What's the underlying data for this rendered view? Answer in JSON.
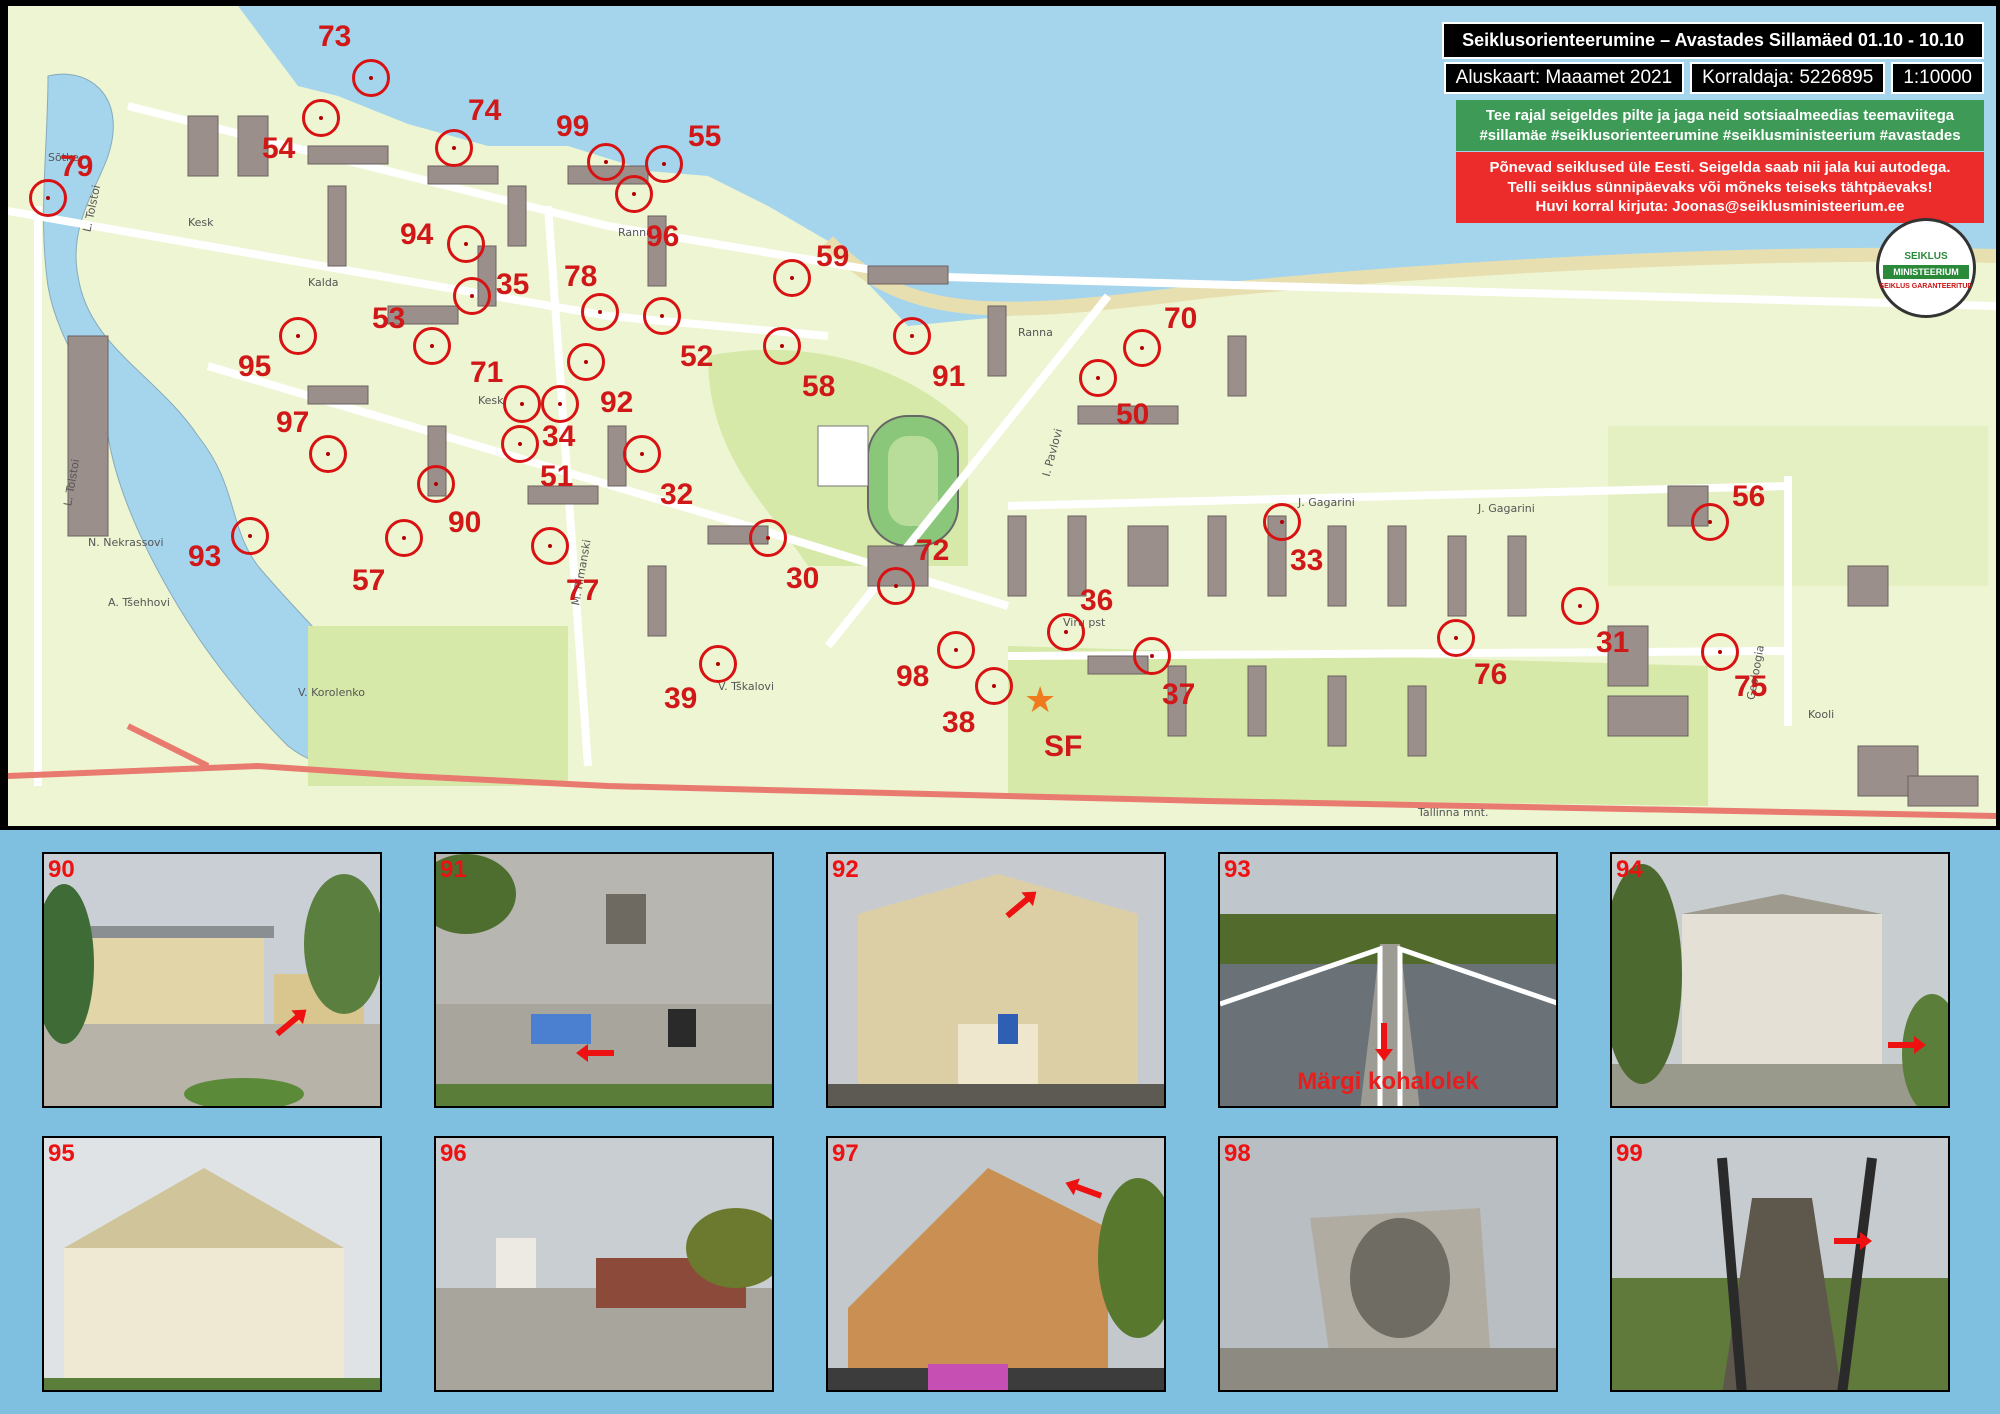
{
  "header": {
    "title": "Seiklusorienteerumine – Avastades Sillamäed 01.10 - 10.10",
    "base_map": "Aluskaart: Maaamet 2021",
    "organizer": "Korraldaja: 5226895",
    "scale": "1:10000",
    "share_note": "Tee rajal seigeldes pilte ja jaga neid sotsiaalmeedias teemaviitega",
    "hashtags": "#sillamäe #seiklusorienteerumine #seiklusministeerium #avastades",
    "promo_1": "Põnevad seiklused üle Eesti. Seigelda saab nii jala kui autodega.",
    "promo_2": "Telli seiklus sünnipäevaks või mõneks teiseks tähtpäevaks!",
    "promo_3": "Huvi korral kirjuta: Joonas@seiklusministeerium.ee"
  },
  "logo": {
    "line1": "SEIKLUS",
    "line2": "MINISTEERIUM",
    "line3": "SEIKLUS GARANTEERITUD"
  },
  "start": {
    "label": "SF"
  },
  "controls": [
    {
      "id": "73"
    },
    {
      "id": "54"
    },
    {
      "id": "74"
    },
    {
      "id": "99"
    },
    {
      "id": "55"
    },
    {
      "id": "79"
    },
    {
      "id": "96"
    },
    {
      "id": "94"
    },
    {
      "id": "35"
    },
    {
      "id": "78"
    },
    {
      "id": "59"
    },
    {
      "id": "53"
    },
    {
      "id": "95"
    },
    {
      "id": "52"
    },
    {
      "id": "58"
    },
    {
      "id": "91"
    },
    {
      "id": "70"
    },
    {
      "id": "71"
    },
    {
      "id": "92"
    },
    {
      "id": "50"
    },
    {
      "id": "97"
    },
    {
      "id": "34"
    },
    {
      "id": "51"
    },
    {
      "id": "32"
    },
    {
      "id": "90"
    },
    {
      "id": "93"
    },
    {
      "id": "57"
    },
    {
      "id": "77"
    },
    {
      "id": "30"
    },
    {
      "id": "72"
    },
    {
      "id": "33"
    },
    {
      "id": "56"
    },
    {
      "id": "36"
    },
    {
      "id": "31"
    },
    {
      "id": "98"
    },
    {
      "id": "76"
    },
    {
      "id": "37"
    },
    {
      "id": "75"
    },
    {
      "id": "39"
    },
    {
      "id": "38"
    }
  ],
  "streets": {
    "sotke": "Sõtke",
    "ranna": "Ranna",
    "kesk": "Kesk",
    "kalda": "Kalda",
    "tolstoi": "L. Tolstoi",
    "nekrassovi": "N. Nekrassovi",
    "tsehhovi": "A. Tšehhovi",
    "korolenko": "V. Korolenko",
    "tallinna": "Tallinna mnt.",
    "gagarini": "J. Gagarini",
    "pavlovi": "I. Pavlovi",
    "viru": "Viru pst",
    "tskalovi": "V. Tškalovi",
    "geoloogia": "Geoloogia",
    "kooli": "Kooli",
    "riimanski": "M. Rimanski"
  },
  "photos": [
    {
      "id": "90",
      "caption": ""
    },
    {
      "id": "91",
      "caption": ""
    },
    {
      "id": "92",
      "caption": ""
    },
    {
      "id": "93",
      "caption": "Märgi kohalolek"
    },
    {
      "id": "94",
      "caption": ""
    },
    {
      "id": "95",
      "caption": ""
    },
    {
      "id": "96",
      "caption": ""
    },
    {
      "id": "97",
      "caption": ""
    },
    {
      "id": "98",
      "caption": ""
    },
    {
      "id": "99",
      "caption": ""
    }
  ]
}
